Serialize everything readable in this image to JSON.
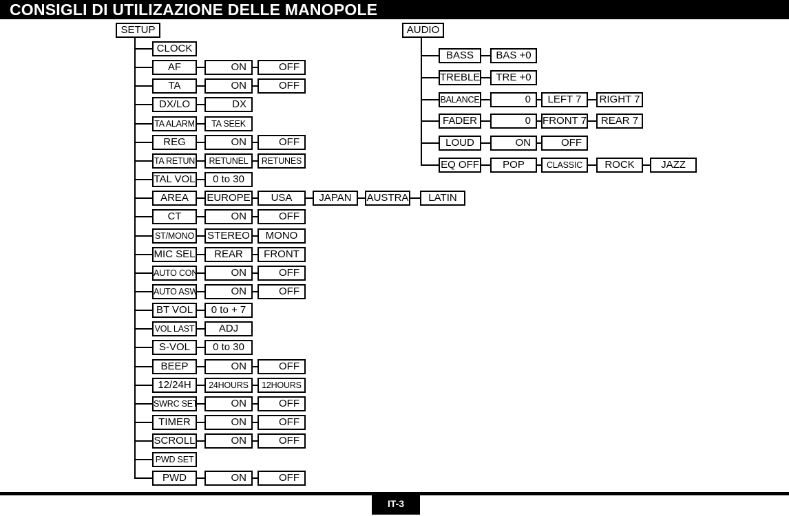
{
  "header": {
    "title": "CONSIGLI DI UTILIZAZIONE DELLE MANOPOLE"
  },
  "footer": {
    "page_label": "IT-3"
  },
  "trees": [
    {
      "id": "setup",
      "root": "SETUP",
      "rows": [
        {
          "label": "CLOCK",
          "values": []
        },
        {
          "label": "AF",
          "values": [
            "ON",
            "OFF"
          ]
        },
        {
          "label": "TA",
          "values": [
            "ON",
            "OFF"
          ]
        },
        {
          "label": "DX/LO",
          "values": [
            "DX"
          ]
        },
        {
          "label": "TA ALARM",
          "values": [
            "TA SEEK"
          ]
        },
        {
          "label": "REG",
          "values": [
            "ON",
            "OFF"
          ]
        },
        {
          "label": "TA RETUN",
          "values": [
            "RETUNEL",
            "RETUNES"
          ]
        },
        {
          "label": "TAL VOL",
          "values": [
            "0 to 30"
          ]
        },
        {
          "label": "AREA",
          "values": [
            "EUROPE",
            "USA",
            "JAPAN",
            "AUSTRA",
            "LATIN"
          ]
        },
        {
          "label": "CT",
          "values": [
            "ON",
            "OFF"
          ]
        },
        {
          "label": "ST/MONO",
          "values": [
            "STEREO",
            "MONO"
          ]
        },
        {
          "label": "MIC SEL",
          "values": [
            "REAR",
            "FRONT"
          ]
        },
        {
          "label": "AUTO CON",
          "values": [
            "ON",
            "OFF"
          ]
        },
        {
          "label": "AUTO ASW",
          "values": [
            "ON",
            "OFF"
          ]
        },
        {
          "label": "BT VOL",
          "values": [
            "0 to + 7"
          ]
        },
        {
          "label": "VOL LAST",
          "values": [
            "ADJ"
          ]
        },
        {
          "label": "S-VOL",
          "values": [
            "0 to 30"
          ]
        },
        {
          "label": "BEEP",
          "values": [
            "ON",
            "OFF"
          ]
        },
        {
          "label": "12/24H",
          "values": [
            "24HOURS",
            "12HOURS"
          ]
        },
        {
          "label": "SWRC SET",
          "values": [
            "ON",
            "OFF"
          ]
        },
        {
          "label": "TIMER",
          "values": [
            "ON",
            "OFF"
          ]
        },
        {
          "label": "SCROLL",
          "values": [
            "ON",
            "OFF"
          ]
        },
        {
          "label": "PWD SET",
          "values": []
        },
        {
          "label": "PWD",
          "values": [
            "ON",
            "OFF"
          ]
        }
      ]
    },
    {
      "id": "audio",
      "root": "AUDIO",
      "rows": [
        {
          "label": "BASS",
          "values": [
            "BAS +0"
          ]
        },
        {
          "label": "TREBLE",
          "values": [
            "TRE +0"
          ]
        },
        {
          "label": "BALANCE",
          "values": [
            "0",
            "LEFT 7",
            "RIGHT 7"
          ]
        },
        {
          "label": "FADER",
          "values": [
            "0",
            "FRONT 7",
            "REAR 7"
          ]
        },
        {
          "label": "LOUD",
          "values": [
            "ON",
            "OFF"
          ]
        },
        {
          "label": "EQ OFF",
          "values": [
            "POP",
            "CLASSIC",
            "ROCK",
            "JAZZ"
          ]
        }
      ]
    }
  ]
}
